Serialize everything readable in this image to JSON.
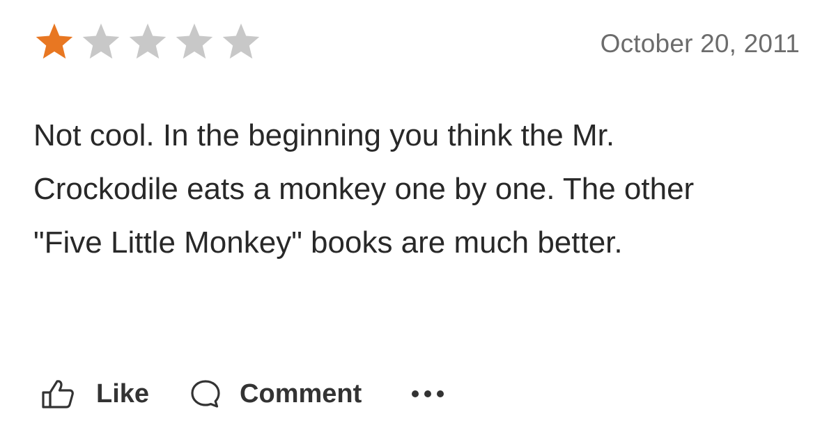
{
  "review": {
    "rating": 1,
    "max_rating": 5,
    "star_filled_color": "#E87722",
    "star_empty_color": "#C8C8C8",
    "date": "October 20, 2011",
    "text": "Not cool. In the beginning you think the Mr. Crockodile eats a monkey one by one. The other \"Five Little Monkey\" books are much better."
  },
  "actions": {
    "like_label": "Like",
    "like_icon": "thumbs-up-icon",
    "comment_label": "Comment",
    "comment_icon": "speech-bubble-icon",
    "more_icon": "more-dots-icon"
  }
}
